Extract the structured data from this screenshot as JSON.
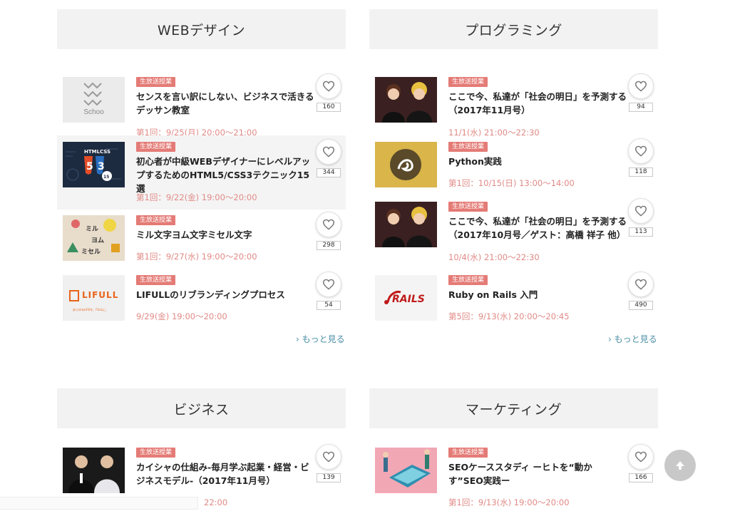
{
  "sections": [
    {
      "title": "WEBデザイン",
      "courses": [
        {
          "badge": "生放送授業",
          "title": "センスを言い訳にしない、ビジネスで活きるデッサン教室",
          "date": "第1回：9/25(月) 20:00〜21:00",
          "likes": "160",
          "thumb_text": "Schoo"
        },
        {
          "badge": "生放送授業",
          "title": "初心者が中級WEBデザイナーにレベルアップするためのHTML5/CSS3テクニック15選",
          "date": "第1回：9/22(金) 19:00〜20:00",
          "likes": "344"
        },
        {
          "badge": "生放送授業",
          "title": "ミル文字ヨム文字ミセル文字",
          "date": "第1回：9/27(水) 19:00〜20:00",
          "likes": "298"
        },
        {
          "badge": "生放送授業",
          "title": "LIFULLのリブランディングプロセス",
          "date": "9/29(金) 19:00〜20:00",
          "likes": "54",
          "thumb_text": "LIFULL"
        }
      ],
      "more": "› もっと見る"
    },
    {
      "title": "プログラミング",
      "courses": [
        {
          "badge": "生放送授業",
          "title": "ここで今、私達が「社会の明日」を予測する（2017年11月号）",
          "date": "11/1(水) 21:00〜22:30",
          "likes": "94"
        },
        {
          "badge": "生放送授業",
          "title": "Python実践",
          "date": "第1回：10/15(日) 13:00〜14:00",
          "likes": "118"
        },
        {
          "badge": "生放送授業",
          "title": "ここで今、私達が「社会の明日」を予測する（2017年10月号／ゲスト：高橋 祥子 他）",
          "date": "10/4(水) 21:00〜22:30",
          "likes": "113"
        },
        {
          "badge": "生放送授業",
          "title": "Ruby on Rails 入門",
          "date": "第5回：9/13(水) 20:00〜20:45",
          "likes": "490",
          "thumb_text": "RAILS"
        }
      ],
      "more": "› もっと見る"
    },
    {
      "title": "ビジネス",
      "courses": [
        {
          "badge": "生放送授業",
          "title": "カイシャの仕組み-毎月学ぶ起業・経営・ビジネスモデル-（2017年11月号）",
          "date": "22:00",
          "likes": "139"
        }
      ]
    },
    {
      "title": "マーケティング",
      "courses": [
        {
          "badge": "生放送授業",
          "title": "SEOケーススタディ ーヒトを“動かす”SEO実践ー",
          "date": "第1回：9/13(水) 19:00〜20:00",
          "likes": "166"
        }
      ]
    }
  ],
  "colors": {
    "badge": "#e47b76",
    "date": "#e08a86",
    "more_link": "#4a8fa6",
    "header_bg": "#f2f2f2"
  },
  "icons": {
    "like": "heart-icon",
    "scroll_top": "arrow-up-icon"
  }
}
